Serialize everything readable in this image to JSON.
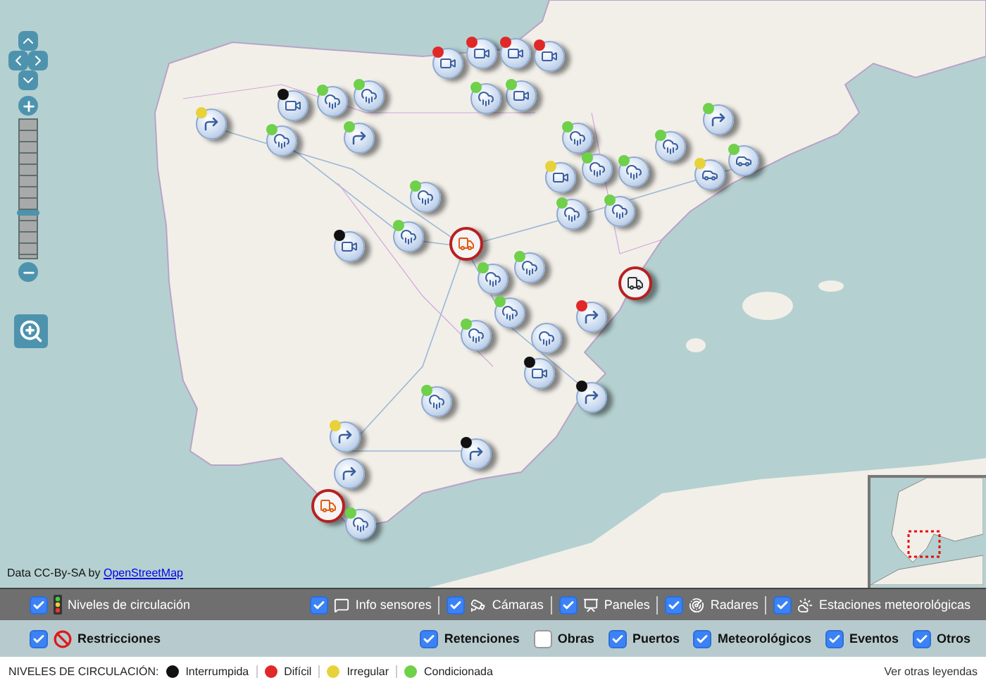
{
  "map": {
    "zoom": {
      "level": 0.33
    },
    "attribution": {
      "text": "Data CC-By-SA by",
      "link": "OpenStreetMap"
    },
    "markers": [
      {
        "kind": "turn",
        "color": "#e8d23a"
      },
      {
        "kind": "camera",
        "color": "#111111"
      },
      {
        "kind": "weather",
        "color": "#6fd04a"
      },
      {
        "kind": "weather",
        "color": "#6fd04a"
      },
      {
        "kind": "weather",
        "color": "#6fd04a"
      },
      {
        "kind": "turn",
        "color": "#6fd04a"
      },
      {
        "kind": "camera",
        "color": "#e02828"
      },
      {
        "kind": "camera",
        "color": "#e02828"
      },
      {
        "kind": "camera",
        "color": "#e02828"
      },
      {
        "kind": "camera",
        "color": "#e02828"
      },
      {
        "kind": "camera",
        "color": "#6fd04a"
      },
      {
        "kind": "weather",
        "color": "#6fd04a"
      },
      {
        "kind": "weather",
        "color": "#6fd04a"
      },
      {
        "kind": "weather",
        "color": "#6fd04a"
      },
      {
        "kind": "camera",
        "color": "#111111"
      },
      {
        "kind": "truck"
      },
      {
        "kind": "weather",
        "color": "#6fd04a"
      },
      {
        "kind": "camera",
        "color": "#e8d23a"
      },
      {
        "kind": "weather",
        "color": "#6fd04a"
      },
      {
        "kind": "weather",
        "color": "#6fd04a"
      },
      {
        "kind": "weather",
        "color": "#6fd04a"
      },
      {
        "kind": "weather",
        "color": "#6fd04a"
      },
      {
        "kind": "weather",
        "color": "#6fd04a"
      },
      {
        "kind": "turn",
        "color": "#6fd04a"
      },
      {
        "kind": "cars",
        "color": "#6fd04a"
      },
      {
        "kind": "cars",
        "color": "#e8d23a"
      },
      {
        "kind": "van"
      },
      {
        "kind": "weather",
        "color": "#6fd04a"
      },
      {
        "kind": "weather",
        "color": "#6fd04a"
      },
      {
        "kind": "weather",
        "color": "#6fd04a"
      },
      {
        "kind": "weather",
        "color": "#6fd04a"
      },
      {
        "kind": "weather"
      },
      {
        "kind": "turn",
        "color": "#e02828"
      },
      {
        "kind": "camera",
        "color": "#111111"
      },
      {
        "kind": "turn",
        "color": "#111111"
      },
      {
        "kind": "weather",
        "color": "#6fd04a"
      },
      {
        "kind": "turn",
        "color": "#111111"
      },
      {
        "kind": "turn",
        "color": "#e8d23a"
      },
      {
        "kind": "turn"
      },
      {
        "kind": "truck"
      },
      {
        "kind": "weather",
        "color": "#6fd04a"
      }
    ]
  },
  "layer_bar": [
    {
      "kind": "traffic",
      "label": "Niveles de circulación",
      "checked": true
    },
    {
      "kind": "sensor",
      "label": "Info sensores",
      "checked": true
    },
    {
      "kind": "camera",
      "label": "Cámaras",
      "checked": true
    },
    {
      "kind": "panel",
      "label": "Paneles",
      "checked": true
    },
    {
      "kind": "radar",
      "label": "Radares",
      "checked": true
    },
    {
      "kind": "weather",
      "label": "Estaciones meteorológicas",
      "checked": true
    }
  ],
  "incident_bar": [
    {
      "kind": "restriction",
      "label": "Restricciones",
      "checked": true
    },
    {
      "label": "Retenciones",
      "checked": true
    },
    {
      "label": "Obras",
      "checked": false
    },
    {
      "label": "Puertos",
      "checked": true
    },
    {
      "label": "Meteorológicos",
      "checked": true
    },
    {
      "label": "Eventos",
      "checked": true
    },
    {
      "label": "Otros",
      "checked": true
    }
  ],
  "legend": {
    "title": "NIVELES DE CIRCULACIÓN:",
    "items": [
      {
        "label": "Interrumpida",
        "color": "#111111"
      },
      {
        "label": "Difícil",
        "color": "#e02828"
      },
      {
        "label": "Irregular",
        "color": "#e8d23a"
      },
      {
        "label": "Condicionada",
        "color": "#6fd04a"
      }
    ],
    "link": "Ver otras leyendas"
  }
}
